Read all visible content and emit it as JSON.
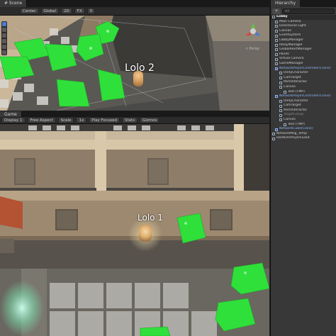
{
  "scene": {
    "tab_label": "# Scene",
    "toolbar": [
      "Center",
      "Global",
      "2D",
      "FX",
      "0"
    ],
    "player_label": "Lolo 2",
    "gizmo_label": "< Persp"
  },
  "game": {
    "tab_label": "Game",
    "toolbar": [
      "Display 1",
      "Free Aspect",
      "Scale",
      "1x",
      "Play Focused",
      "Stats",
      "Gizmos"
    ],
    "player_label": "Lolo 1"
  },
  "hierarchy": {
    "tab_label": "Hierarchy",
    "add_label": "+",
    "search_placeholder": "All",
    "items": [
      {
        "label": "Lobby",
        "depth": 0,
        "style": "root"
      },
      {
        "label": "Main Camera",
        "depth": 1,
        "style": "normal"
      },
      {
        "label": "Directional Light",
        "depth": 1,
        "style": "normal"
      },
      {
        "label": "Canvas",
        "depth": 1,
        "style": "normal"
      },
      {
        "label": "EventSystem",
        "depth": 1,
        "style": "normal"
      },
      {
        "label": "LobbyManager",
        "depth": 1,
        "style": "normal"
      },
      {
        "label": "RelayManager",
        "depth": 1,
        "style": "normal"
      },
      {
        "label": "GlobalAlertManager",
        "depth": 1,
        "style": "normal"
      },
      {
        "label": "Paints",
        "depth": 1,
        "style": "normal"
      },
      {
        "label": "Virtual Camera",
        "depth": 1,
        "style": "normal"
      },
      {
        "label": "GameManager",
        "depth": 1,
        "style": "normal"
      },
      {
        "label": "NetworkPlayerController(Clone)",
        "depth": 1,
        "style": "blue"
      },
      {
        "label": "UnityCharacter",
        "depth": 2,
        "style": "normal"
      },
      {
        "label": "CamTarget",
        "depth": 2,
        "style": "normal"
      },
      {
        "label": "ItemInteractor",
        "depth": 2,
        "style": "normal"
      },
      {
        "label": "Canvas",
        "depth": 2,
        "style": "normal"
      },
      {
        "label": "Text (TMP)",
        "depth": 3,
        "style": "normal"
      },
      {
        "label": "NetworkPlayerController(Clone)",
        "depth": 1,
        "style": "blue"
      },
      {
        "label": "UnityCharacter",
        "depth": 2,
        "style": "normal"
      },
      {
        "label": "CamTarget",
        "depth": 2,
        "style": "normal"
      },
      {
        "label": "ItemInteractor",
        "depth": 2,
        "style": "normal"
      },
      {
        "label": "TargetGroup",
        "depth": 2,
        "style": "gray"
      },
      {
        "label": "Canvas",
        "depth": 2,
        "style": "normal"
      },
      {
        "label": "Text (TMP)",
        "depth": 3,
        "style": "normal"
      },
      {
        "label": "NetworkCube(Clone)",
        "depth": 1,
        "style": "blue"
      },
      {
        "label": "NetworkMsg_Temp",
        "depth": 0,
        "style": "normal"
      },
      {
        "label": "DontDestroyOnLoad",
        "depth": 0,
        "style": "normal"
      }
    ]
  },
  "colors": {
    "cube_green": "#2fe03a",
    "selection_blue": "#8ab4f8",
    "editor_bg": "#383838"
  }
}
